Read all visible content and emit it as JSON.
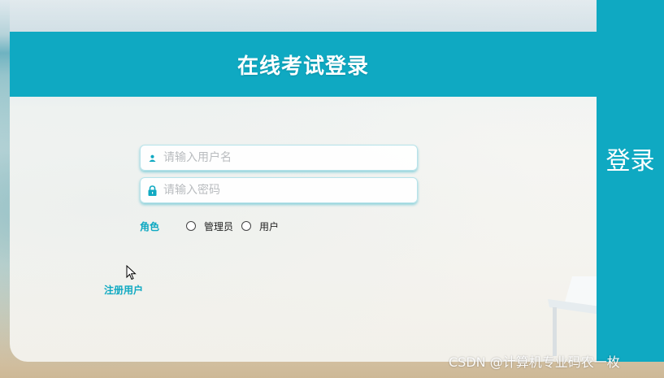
{
  "header": {
    "title": "在线考试登录"
  },
  "login_button": {
    "label": "登录"
  },
  "form": {
    "username": {
      "placeholder": "请输入用户名",
      "value": ""
    },
    "password": {
      "placeholder": "请输入密码",
      "value": ""
    },
    "role": {
      "label": "角色",
      "options": [
        "管理员",
        "用户"
      ]
    }
  },
  "register_link": {
    "label": "注册用户"
  },
  "watermark": {
    "text": "CSDN @计算机专业码农一枚"
  },
  "colors": {
    "accent": "#0fa9c2"
  },
  "icons": {
    "username": "user-icon",
    "password": "lock-icon"
  }
}
